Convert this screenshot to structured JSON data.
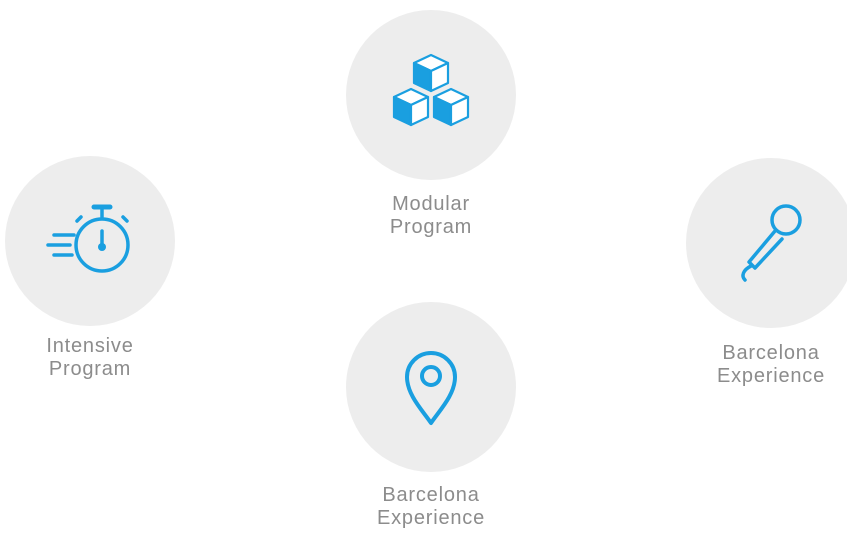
{
  "colors": {
    "accent": "#1a9fe0",
    "circle_bg": "#ededed",
    "label_text": "#8c8c8c"
  },
  "programs": [
    {
      "icon": "cubes-icon",
      "line1": "Modular",
      "line2": "Program"
    },
    {
      "icon": "stopwatch-icon",
      "line1": "Intensive",
      "line2": "Program"
    },
    {
      "icon": "microphone-icon",
      "line1": "Barcelona",
      "line2": "Experience"
    },
    {
      "icon": "location-pin-icon",
      "line1": "Barcelona",
      "line2": "Experience"
    }
  ]
}
